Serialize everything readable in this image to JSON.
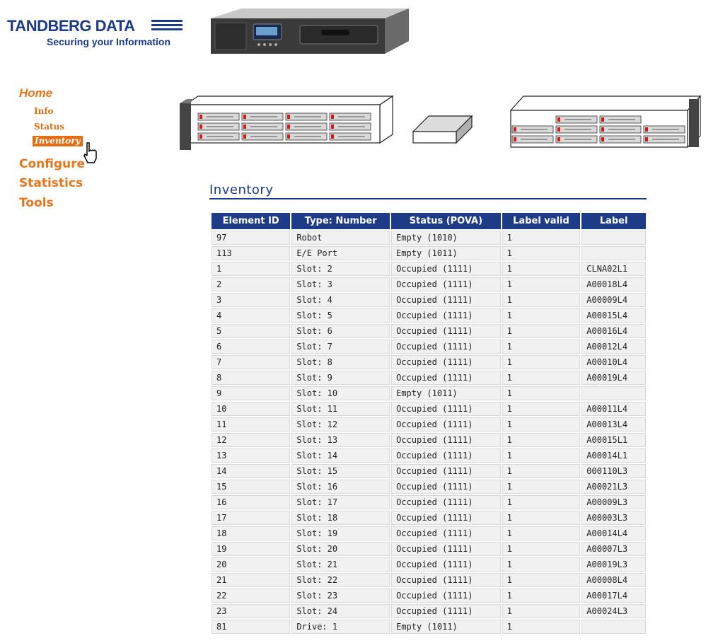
{
  "brand": {
    "name": "TANDBERG DATA",
    "tagline": "Securing your Information",
    "color": "#1d3b86"
  },
  "nav": {
    "home": "Home",
    "info": "Info",
    "status": "Status",
    "inventory": "Inventory",
    "configure": "Configure",
    "statistics": "Statistics",
    "tools": "Tools",
    "accent": "#e8761e"
  },
  "page": {
    "title": "Inventory"
  },
  "table": {
    "headers": [
      "Element ID",
      "Type: Number",
      "Status (POVA)",
      "Label valid",
      "Label"
    ],
    "rows": [
      [
        "97",
        "Robot",
        "Empty (1010)",
        "1",
        ""
      ],
      [
        "113",
        "E/E Port",
        "Empty (1011)",
        "1",
        ""
      ],
      [
        "1",
        "Slot: 2",
        "Occupied (1111)",
        "1",
        "CLNA02L1"
      ],
      [
        "2",
        "Slot: 3",
        "Occupied (1111)",
        "1",
        "A00018L4"
      ],
      [
        "3",
        "Slot: 4",
        "Occupied (1111)",
        "1",
        "A00009L4"
      ],
      [
        "4",
        "Slot: 5",
        "Occupied (1111)",
        "1",
        "A00015L4"
      ],
      [
        "5",
        "Slot: 6",
        "Occupied (1111)",
        "1",
        "A00016L4"
      ],
      [
        "6",
        "Slot: 7",
        "Occupied (1111)",
        "1",
        "A00012L4"
      ],
      [
        "7",
        "Slot: 8",
        "Occupied (1111)",
        "1",
        "A00010L4"
      ],
      [
        "8",
        "Slot: 9",
        "Occupied (1111)",
        "1",
        "A00019L4"
      ],
      [
        "9",
        "Slot: 10",
        "Empty (1011)",
        "1",
        ""
      ],
      [
        "10",
        "Slot: 11",
        "Occupied (1111)",
        "1",
        "A00011L4"
      ],
      [
        "11",
        "Slot: 12",
        "Occupied (1111)",
        "1",
        "A00013L4"
      ],
      [
        "12",
        "Slot: 13",
        "Occupied (1111)",
        "1",
        "A00015L1"
      ],
      [
        "13",
        "Slot: 14",
        "Occupied (1111)",
        "1",
        "A00014L1"
      ],
      [
        "14",
        "Slot: 15",
        "Occupied (1111)",
        "1",
        "000110L3"
      ],
      [
        "15",
        "Slot: 16",
        "Occupied (1111)",
        "1",
        "A00021L3"
      ],
      [
        "16",
        "Slot: 17",
        "Occupied (1111)",
        "1",
        "A00009L3"
      ],
      [
        "17",
        "Slot: 18",
        "Occupied (1111)",
        "1",
        "A00003L3"
      ],
      [
        "18",
        "Slot: 19",
        "Occupied (1111)",
        "1",
        "A00014L4"
      ],
      [
        "19",
        "Slot: 20",
        "Occupied (1111)",
        "1",
        "A00007L3"
      ],
      [
        "20",
        "Slot: 21",
        "Occupied (1111)",
        "1",
        "A00019L3"
      ],
      [
        "21",
        "Slot: 22",
        "Occupied (1111)",
        "1",
        "A00008L4"
      ],
      [
        "22",
        "Slot: 23",
        "Occupied (1111)",
        "1",
        "A00017L4"
      ],
      [
        "23",
        "Slot: 24",
        "Occupied (1111)",
        "1",
        "A00024L3"
      ],
      [
        "81",
        "Drive: 1",
        "Empty (1011)",
        "1",
        ""
      ]
    ]
  },
  "icons": {
    "cursor": "hand-pointer-icon",
    "device": "tape-library-device",
    "diagram": "magazine-and-drive-diagram"
  }
}
